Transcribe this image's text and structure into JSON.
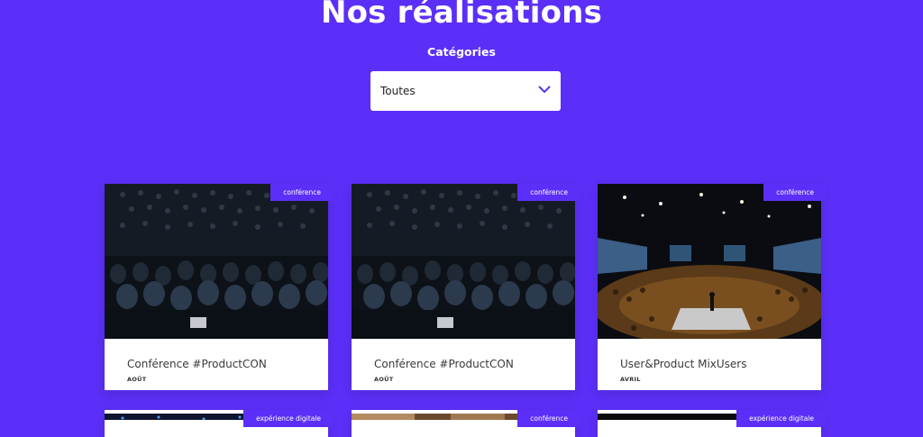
{
  "header": {
    "title": "Nos réalisations",
    "filter_label": "Catégories"
  },
  "filter": {
    "selected": "Toutes"
  },
  "cards": [
    {
      "title": "Conférence #ProductCON",
      "date": "AOÛT",
      "category": "conférence"
    },
    {
      "title": "Conférence #ProductCON",
      "date": "AOÛT",
      "category": "conférence"
    },
    {
      "title": "User&Product MixUsers",
      "date": "AVRIL",
      "category": "conférence"
    },
    {
      "category": "expérience digitale"
    },
    {
      "category": "conférence"
    },
    {
      "category": "expérience digitale"
    }
  ],
  "colors": {
    "background": "#5b2ff7",
    "badge": "#5b2ff7",
    "chevron": "#5b2ff7"
  }
}
